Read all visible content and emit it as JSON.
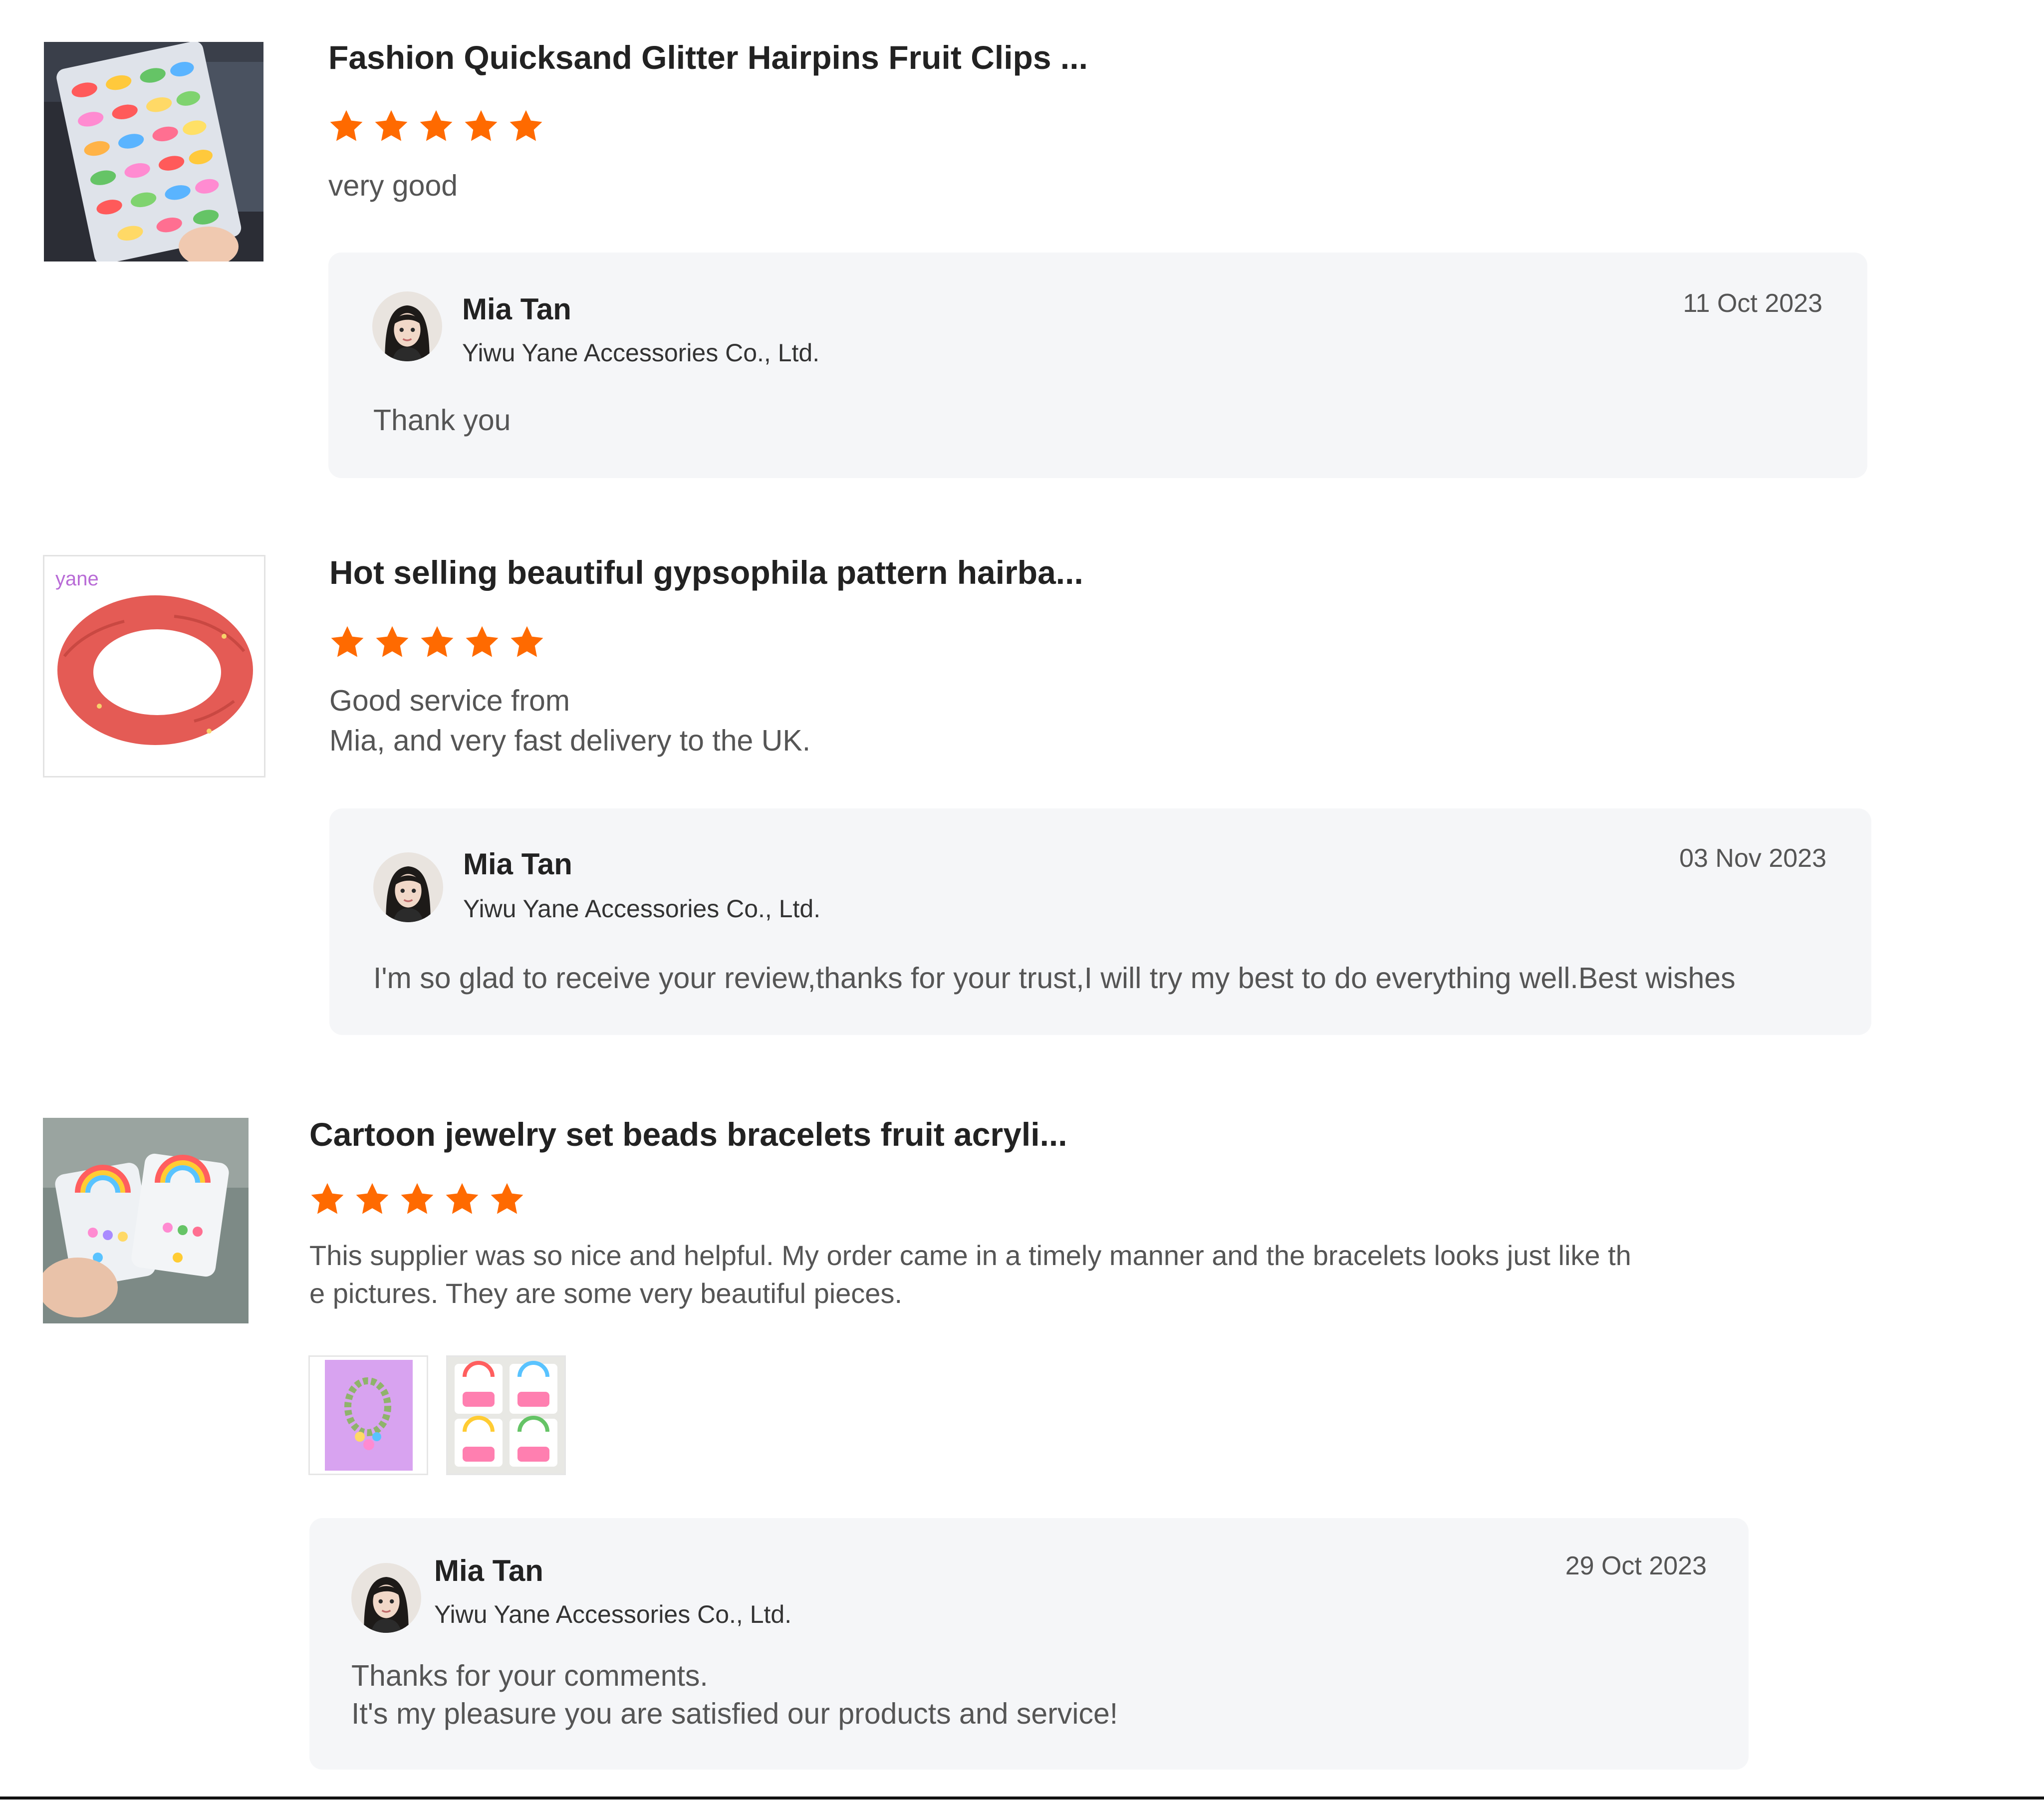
{
  "accent_color": "#ff6a00",
  "reviews": [
    {
      "product_title": "Fashion Quicksand Glitter Hairpins Fruit Clips ...",
      "rating": 5,
      "text": "very good",
      "reply": {
        "name": "Mia Tan",
        "company": "Yiwu Yane Accessories Co., Ltd.",
        "date": "11 Oct 2023",
        "text": "Thank you"
      }
    },
    {
      "product_title": "Hot selling beautiful gypsophila pattern hairba...",
      "rating": 5,
      "text": "Good service from\nMia, and very fast delivery to the UK.",
      "product_image_label": "yane",
      "reply": {
        "name": "Mia Tan",
        "company": "Yiwu Yane Accessories Co., Ltd.",
        "date": "03 Nov 2023",
        "text": "I'm so glad to  receive your review,thanks for your trust,I will try my best to do everything well.Best wishes"
      }
    },
    {
      "product_title": "Cartoon jewelry set beads bracelets fruit acryli...",
      "rating": 5,
      "text": "This supplier was so nice and helpful. My order came in a timely manner and the bracelets looks just like th\ne pictures. They are some very beautiful pieces.",
      "attachments": [
        "bracelet-photo",
        "bracelet-cards-photo"
      ],
      "reply": {
        "name": "Mia Tan",
        "company": "Yiwu Yane Accessories Co., Ltd.",
        "date": "29 Oct 2023",
        "text": "Thanks for your comments.\nIt's my pleasure you are satisfied our products and service!"
      }
    }
  ]
}
